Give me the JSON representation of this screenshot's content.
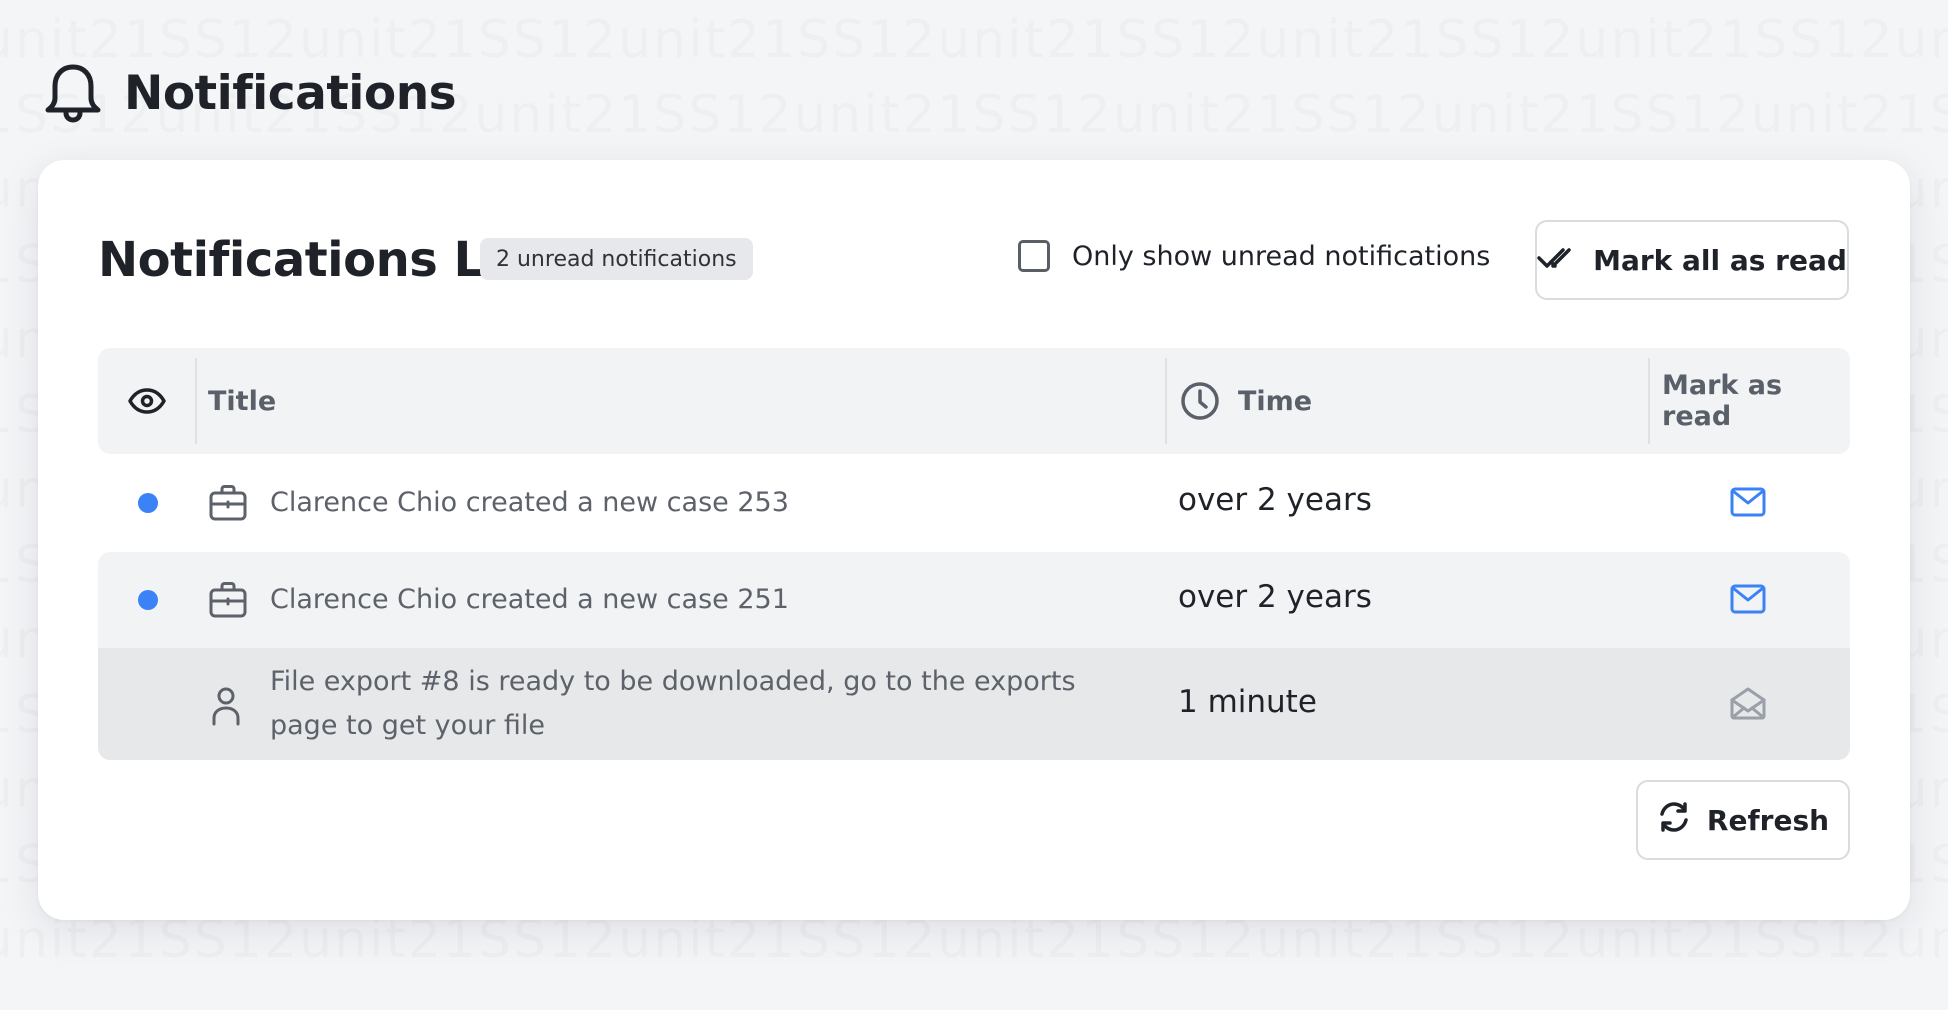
{
  "page": {
    "title": "Notifications",
    "icon": "bell-icon"
  },
  "card": {
    "title": "Notifications List",
    "unread_badge": "2 unread notifications",
    "filter_label": "Only show unread notifications",
    "filter_checked": false,
    "mark_all_label": "Mark all as read",
    "refresh_label": "Refresh"
  },
  "table": {
    "columns": {
      "status_icon": "eye-icon",
      "title": "Title",
      "time_icon": "clock-icon",
      "time": "Time",
      "mark": "Mark as read"
    },
    "rows": [
      {
        "unread": true,
        "icon": "briefcase-icon",
        "title": "Clarence Chio created a new case 253",
        "time": "over 2 years",
        "mark_icon": "mail-closed-icon"
      },
      {
        "unread": true,
        "icon": "briefcase-icon",
        "title": "Clarence Chio created a new case 251",
        "time": "over 2 years",
        "mark_icon": "mail-closed-icon"
      },
      {
        "unread": false,
        "icon": "user-icon",
        "title": "File export #8 is ready to be downloaded, go to the exports page to get your file",
        "time": "1 minute",
        "mark_icon": "mail-open-icon"
      }
    ]
  },
  "colors": {
    "accent": "#3b82f6",
    "muted_icon": "#9aa0a8",
    "background": "#f4f5f7"
  }
}
